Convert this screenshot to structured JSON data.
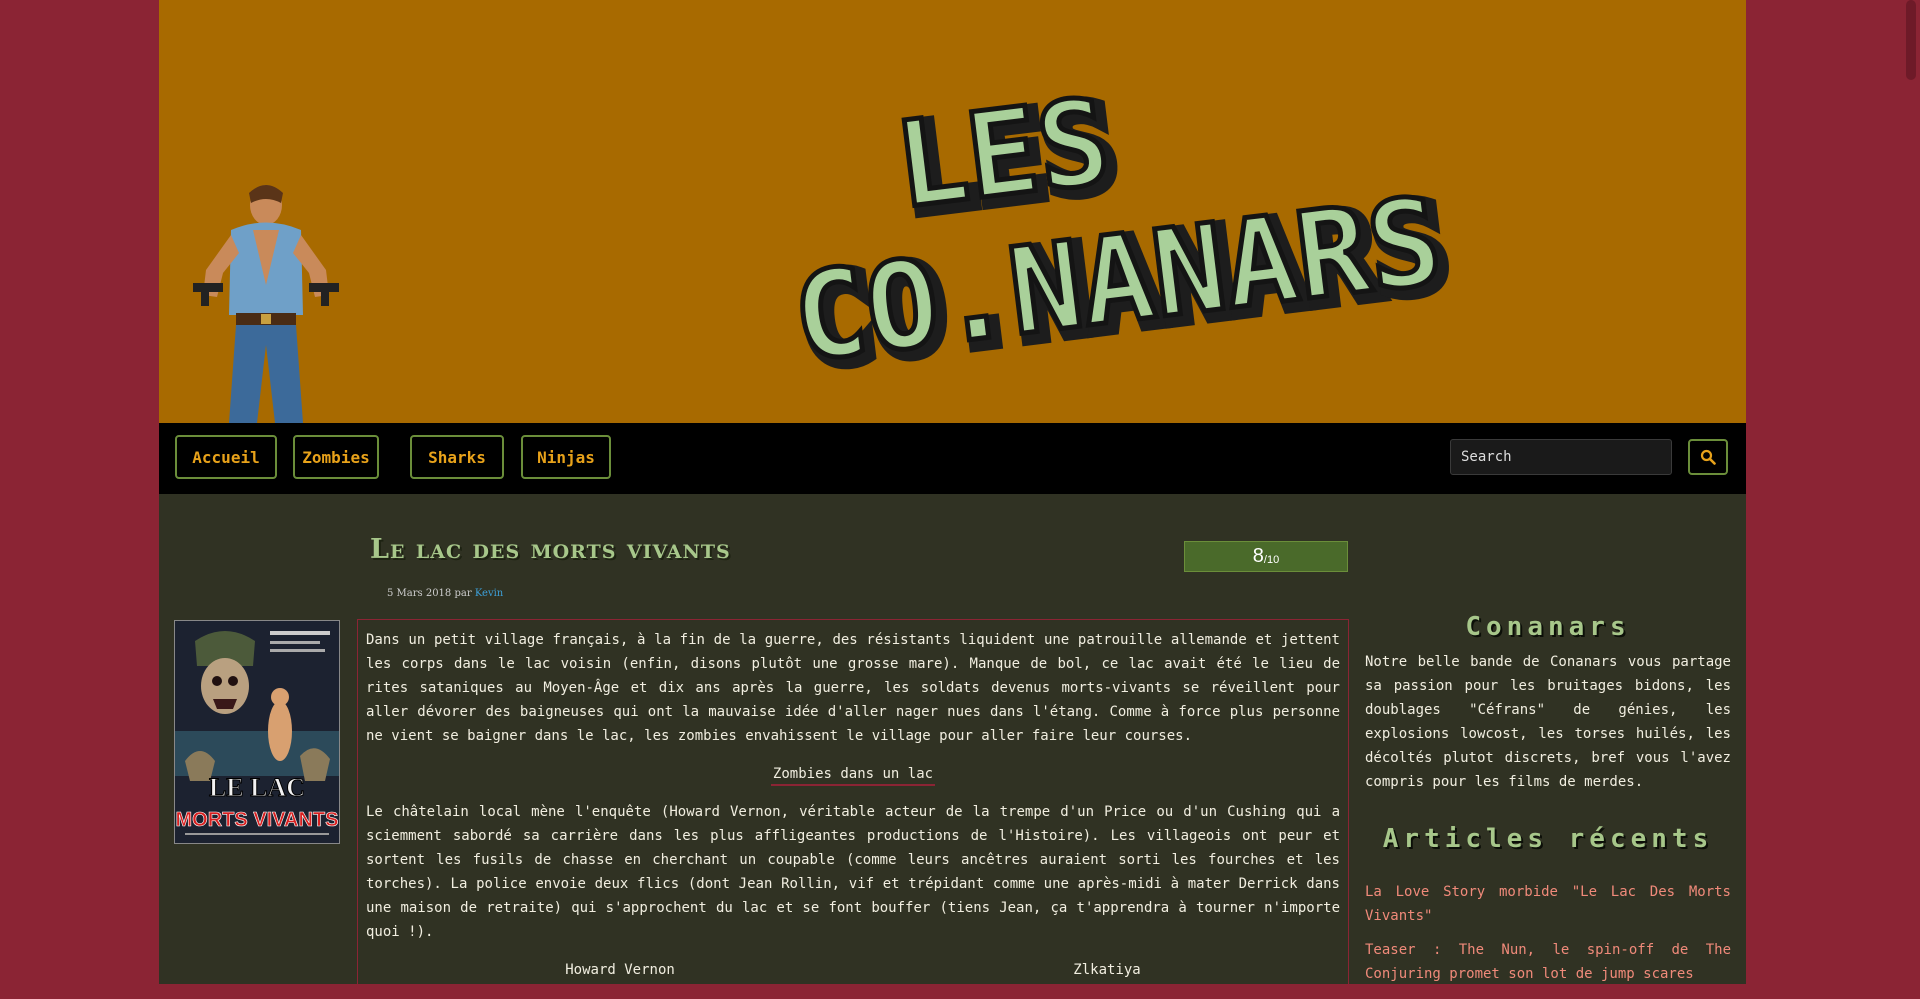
{
  "site": {
    "logo_line1": "LES",
    "logo_line2": "CO.NANARS"
  },
  "nav": {
    "items": [
      {
        "label": "Accueil"
      },
      {
        "label": "Zombies"
      },
      {
        "label": "Sharks"
      },
      {
        "label": "Ninjas"
      }
    ],
    "search_placeholder": "Search"
  },
  "post": {
    "title": "Le lac des morts vivants",
    "score": "8",
    "score_max": "/10",
    "date": "5 Mars 2018",
    "by": "par",
    "author": "Kevin",
    "poster_title_line1": "LE LAC",
    "poster_title_line2": "MORTS VIVANTS",
    "paragraph1": "Dans un petit village français, à la fin de la guerre, des résistants liquident une patrouille allemande et jettent les corps dans le lac voisin (enfin, disons plutôt une grosse mare). Manque de bol, ce lac avait été le lieu de rites sataniques au Moyen-Âge et dix ans après la guerre, les soldats devenus morts-vivants se réveillent pour aller dévorer des baigneuses qui ont la mauvaise idée d'aller nager nues dans l'étang. Comme à force plus personne ne vient se baigner dans le lac, les zombies envahissent le village pour aller faire leur courses.",
    "image1_alt": "Zombies dans un lac",
    "paragraph2": "Le châtelain local mène l'enquête (Howard Vernon, véritable acteur de la trempe d'un Price ou d'un Cushing qui a sciemment sabordé sa carrière dans les plus affligeantes productions de l'Histoire). Les villageois ont peur et sortent les fusils de chasse en cherchant un coupable (comme leurs ancêtres auraient sorti les fourches et les torches). La police envoie deux flics (dont Jean Rollin, vif et trépidant comme une après-midi à mater Derrick dans une maison de retraite) qui s'approchent du lac et se font bouffer (tiens Jean, ça t'apprendra à tourner n'importe quoi !).",
    "image2_alt": "Howard Vernon",
    "image3_alt": "Zlkatiya"
  },
  "sidebar": {
    "about_title": "Conanars",
    "about_text": "Notre belle bande de Conanars vous partage sa passion pour les bruitages bidons, les doublages \"Céfrans\" de génies, les explosions lowcost, les torses huilés, les décoltés plutot discrets, bref vous l'avez compris pour les films de merdes.",
    "recent_title": "Articles récents",
    "recent_articles": [
      "La Love Story morbide \"Le Lac Des Morts Vivants\"",
      "Teaser : The Nun, le spin-off de The Conjuring promet son lot de jump scares"
    ]
  },
  "colors": {
    "background": "#8b2434",
    "banner": "#a86a00",
    "navbar": "#000000",
    "content": "#303223",
    "accent_green": "#a7c78a",
    "nav_text": "#e8a21a",
    "link_pink": "#f08a7a",
    "author_blue": "#3da0d8"
  }
}
